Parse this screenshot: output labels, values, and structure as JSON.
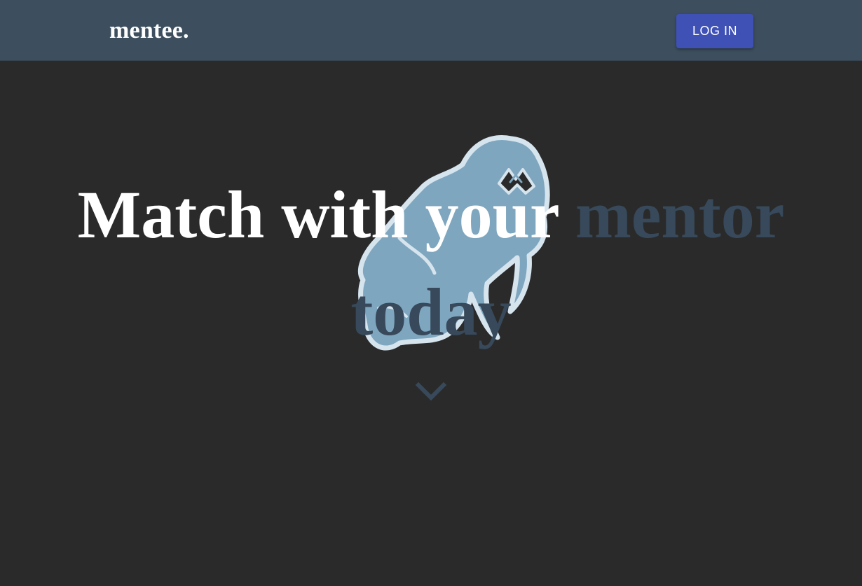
{
  "navbar": {
    "brand": "mentee.",
    "login_label": "LOG IN"
  },
  "hero": {
    "headline_lead": "Match with your",
    "headline_accent_1": "mentor",
    "headline_accent_2": "today",
    "mascot_icon": "walrus-icon",
    "scroll_icon": "chevron-down-icon"
  },
  "colors": {
    "navbar_bg": "#3d4f5e",
    "page_bg": "#2a2a2a",
    "button_bg": "#3f51b5",
    "accent_text": "#37495a",
    "mascot_fill": "#7ea6bf",
    "mascot_outline": "#d6e4ee"
  }
}
